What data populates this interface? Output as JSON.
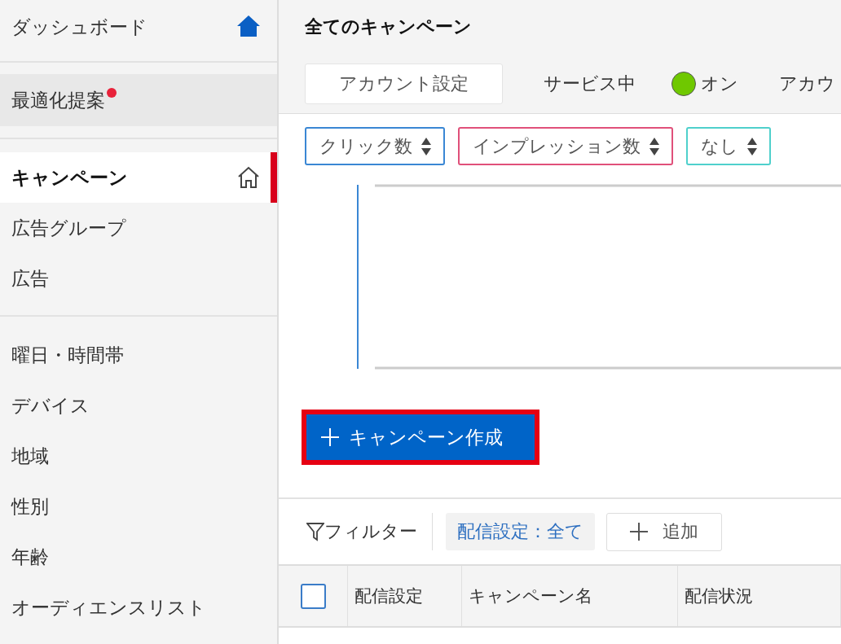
{
  "sidebar": {
    "dashboard": {
      "label": "ダッシュボード"
    },
    "suggestions": {
      "label": "最適化提案",
      "has_notification": true
    },
    "groups": [
      [
        {
          "label": "キャンペーン",
          "selected": true
        },
        {
          "label": "広告グループ",
          "selected": false
        },
        {
          "label": "広告",
          "selected": false
        }
      ],
      [
        {
          "label": "曜日・時間帯",
          "selected": false
        },
        {
          "label": "デバイス",
          "selected": false
        },
        {
          "label": "地域",
          "selected": false
        },
        {
          "label": "性別",
          "selected": false
        },
        {
          "label": "年齢",
          "selected": false
        },
        {
          "label": "オーディエンスリスト",
          "selected": false
        }
      ]
    ]
  },
  "header": {
    "title": "全てのキャンペーン",
    "account_settings_button": "アカウント設定",
    "status_label": "サービス中",
    "status": {
      "on": true,
      "label": "オン"
    },
    "cut_label": "アカウ"
  },
  "metric_selectors": [
    {
      "label": "クリック数",
      "color": "#3a87d4"
    },
    {
      "label": "インプレッション数",
      "color": "#e0507a"
    },
    {
      "label": "なし",
      "color": "#4fd0cc"
    }
  ],
  "create_button": {
    "label": "キャンペーン作成"
  },
  "filter_bar": {
    "label": "フィルター",
    "chips": [
      "配信設定：全て"
    ],
    "add_button": "追加"
  },
  "table": {
    "select_all_checked": false,
    "columns": [
      "配信設定",
      "キャンペーン名",
      "配信状況"
    ]
  }
}
